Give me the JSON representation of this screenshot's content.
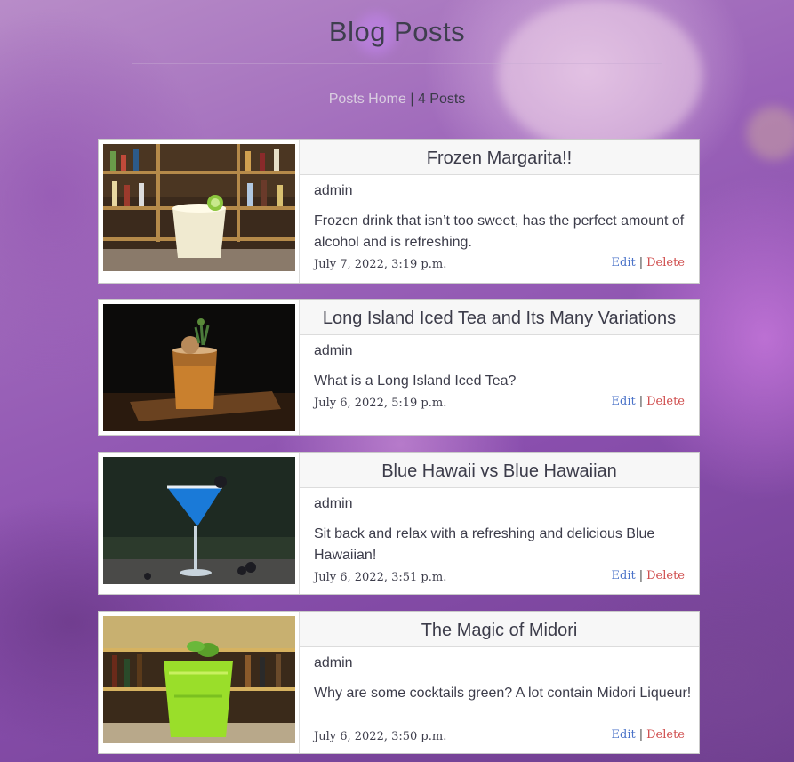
{
  "page": {
    "title": "Blog Posts",
    "nav_link": "Posts Home",
    "separator": "|",
    "post_count": "4 Posts"
  },
  "posts": [
    {
      "title": "Frozen Margarita!!",
      "author": "admin",
      "excerpt": "Frozen drink that isn’t too sweet, has the perfect amount of alcohol and is refreshing.",
      "date": "July 7, 2022, 3:19 p.m.",
      "edit_label": "Edit",
      "delete_label": "Delete",
      "image": "frozen-margarita-photo"
    },
    {
      "title": "Long Island Iced Tea and Its Many Variations",
      "author": "admin",
      "excerpt": "What is a Long Island Iced Tea?",
      "date": "July 6, 2022, 5:19 p.m.",
      "edit_label": "Edit",
      "delete_label": "Delete",
      "image": "long-island-iced-tea-photo"
    },
    {
      "title": "Blue Hawaii vs Blue Hawaiian",
      "author": "admin",
      "excerpt": "Sit back and relax with a refreshing and delicious Blue Hawaiian!",
      "date": "July 6, 2022, 3:51 p.m.",
      "edit_label": "Edit",
      "delete_label": "Delete",
      "image": "blue-hawaiian-photo"
    },
    {
      "title": "The Magic of Midori",
      "author": "admin",
      "excerpt": "Why are some cocktails green? A lot contain Midori Liqueur!",
      "date": "July 6, 2022, 3:50 p.m.",
      "edit_label": "Edit",
      "delete_label": "Delete",
      "image": "midori-cocktail-photo"
    }
  ],
  "colors": {
    "background": "#9a62b8",
    "edit_link": "#4a72c8",
    "delete_link": "#cf4a4a",
    "nav_link": "#d9cde0"
  }
}
